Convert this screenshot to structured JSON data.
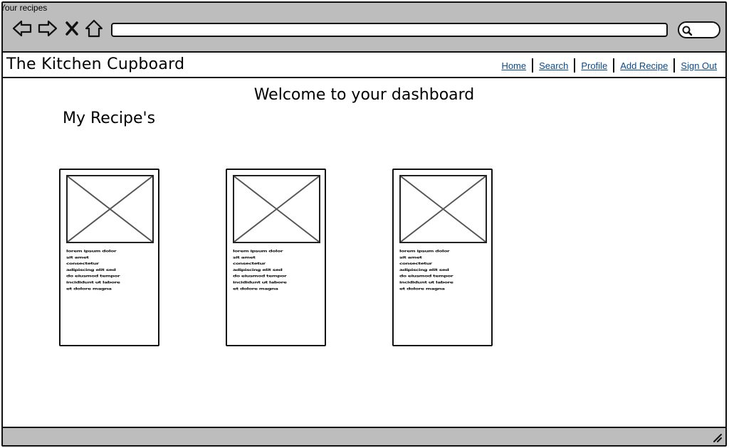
{
  "window": {
    "title": "Your recipes"
  },
  "browser": {
    "url": "",
    "icons": [
      "back-arrow-icon",
      "forward-arrow-icon",
      "close-icon",
      "home-icon",
      "search-icon"
    ]
  },
  "header": {
    "site_title": "The Kitchen Cupboard",
    "nav": [
      {
        "label": "Home"
      },
      {
        "label": "Search"
      },
      {
        "label": "Profile"
      },
      {
        "label": "Add Recipe"
      },
      {
        "label": "Sign Out"
      }
    ]
  },
  "main": {
    "welcome": "Welcome to your dashboard",
    "section_title": "My Recipe's",
    "cards": [
      {
        "lines": [
          "lorem ipsum dolor",
          "sit amet",
          "consectetur",
          "adipiscing elit sed",
          "do eiusmod tempor",
          "incididunt ut labore",
          "et dolore magna"
        ]
      },
      {
        "lines": [
          "lorem ipsum dolor",
          "sit amet",
          "consectetur",
          "adipiscing elit sed",
          "do eiusmod tempor",
          "incididunt ut labore",
          "et dolore magna"
        ]
      },
      {
        "lines": [
          "lorem ipsum dolor",
          "sit amet",
          "consectetur",
          "adipiscing elit sed",
          "do eiusmod tempor",
          "incididunt ut labore",
          "et dolore magna"
        ]
      }
    ]
  }
}
